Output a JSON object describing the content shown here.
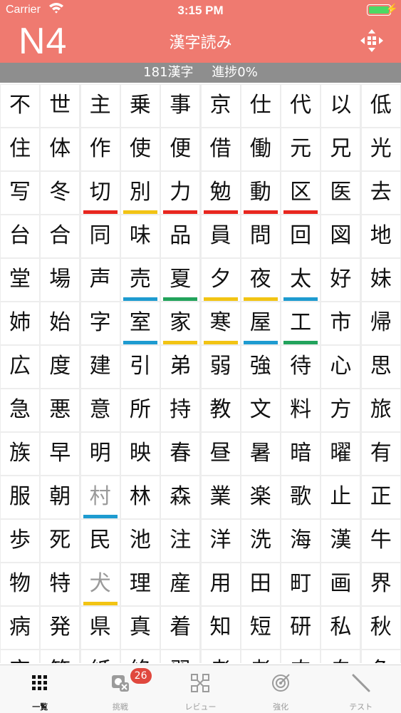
{
  "status_bar": {
    "carrier": "Carrier",
    "time": "3:15 PM"
  },
  "header": {
    "level": "N4",
    "title": "漢字読み",
    "menu_icon": "move-icon"
  },
  "progress": {
    "count_label": "181漢字",
    "progress_label": "進捗0%"
  },
  "colors": {
    "header": "#EF7A70",
    "progress_bar": "#8E8E8E",
    "red": "#E8261F",
    "yellow": "#F2C414",
    "blue": "#1E9BD0",
    "green": "#22A35C",
    "badge": "#E0483E"
  },
  "kanji_rows": [
    [
      {
        "k": "不"
      },
      {
        "k": "世"
      },
      {
        "k": "主"
      },
      {
        "k": "乗"
      },
      {
        "k": "事"
      },
      {
        "k": "京"
      },
      {
        "k": "仕"
      },
      {
        "k": "代"
      },
      {
        "k": "以"
      },
      {
        "k": "低"
      }
    ],
    [
      {
        "k": "住"
      },
      {
        "k": "体"
      },
      {
        "k": "作"
      },
      {
        "k": "使"
      },
      {
        "k": "便"
      },
      {
        "k": "借"
      },
      {
        "k": "働"
      },
      {
        "k": "元"
      },
      {
        "k": "兄"
      },
      {
        "k": "光"
      }
    ],
    [
      {
        "k": "写"
      },
      {
        "k": "冬"
      },
      {
        "k": "切",
        "m": "red"
      },
      {
        "k": "別",
        "m": "yellow"
      },
      {
        "k": "力",
        "m": "red"
      },
      {
        "k": "勉",
        "m": "red"
      },
      {
        "k": "動",
        "m": "red"
      },
      {
        "k": "区",
        "m": "red"
      },
      {
        "k": "医"
      },
      {
        "k": "去"
      }
    ],
    [
      {
        "k": "台"
      },
      {
        "k": "合"
      },
      {
        "k": "同"
      },
      {
        "k": "味"
      },
      {
        "k": "品"
      },
      {
        "k": "員"
      },
      {
        "k": "問"
      },
      {
        "k": "回"
      },
      {
        "k": "図"
      },
      {
        "k": "地"
      }
    ],
    [
      {
        "k": "堂"
      },
      {
        "k": "場"
      },
      {
        "k": "声"
      },
      {
        "k": "売",
        "m": "blue"
      },
      {
        "k": "夏",
        "m": "green"
      },
      {
        "k": "夕",
        "m": "yellow"
      },
      {
        "k": "夜",
        "m": "yellow"
      },
      {
        "k": "太",
        "m": "blue"
      },
      {
        "k": "好"
      },
      {
        "k": "妹"
      }
    ],
    [
      {
        "k": "姉"
      },
      {
        "k": "始"
      },
      {
        "k": "字"
      },
      {
        "k": "室",
        "m": "blue"
      },
      {
        "k": "家",
        "m": "yellow"
      },
      {
        "k": "寒",
        "m": "yellow"
      },
      {
        "k": "屋",
        "m": "blue"
      },
      {
        "k": "工",
        "m": "green"
      },
      {
        "k": "市"
      },
      {
        "k": "帰"
      }
    ],
    [
      {
        "k": "広"
      },
      {
        "k": "度"
      },
      {
        "k": "建"
      },
      {
        "k": "引"
      },
      {
        "k": "弟"
      },
      {
        "k": "弱"
      },
      {
        "k": "強"
      },
      {
        "k": "待"
      },
      {
        "k": "心"
      },
      {
        "k": "思"
      }
    ],
    [
      {
        "k": "急"
      },
      {
        "k": "悪"
      },
      {
        "k": "意"
      },
      {
        "k": "所"
      },
      {
        "k": "持"
      },
      {
        "k": "教"
      },
      {
        "k": "文"
      },
      {
        "k": "料"
      },
      {
        "k": "方"
      },
      {
        "k": "旅"
      }
    ],
    [
      {
        "k": "族"
      },
      {
        "k": "早"
      },
      {
        "k": "明"
      },
      {
        "k": "映"
      },
      {
        "k": "春"
      },
      {
        "k": "昼"
      },
      {
        "k": "暑"
      },
      {
        "k": "暗"
      },
      {
        "k": "曜"
      },
      {
        "k": "有"
      }
    ],
    [
      {
        "k": "服"
      },
      {
        "k": "朝"
      },
      {
        "k": "村",
        "m": "blue",
        "dim": true
      },
      {
        "k": "林"
      },
      {
        "k": "森"
      },
      {
        "k": "業"
      },
      {
        "k": "楽"
      },
      {
        "k": "歌"
      },
      {
        "k": "止"
      },
      {
        "k": "正"
      }
    ],
    [
      {
        "k": "歩"
      },
      {
        "k": "死"
      },
      {
        "k": "民"
      },
      {
        "k": "池"
      },
      {
        "k": "注"
      },
      {
        "k": "洋"
      },
      {
        "k": "洗"
      },
      {
        "k": "海"
      },
      {
        "k": "漢"
      },
      {
        "k": "牛"
      }
    ],
    [
      {
        "k": "物"
      },
      {
        "k": "特"
      },
      {
        "k": "犬",
        "m": "yellow",
        "dim": true
      },
      {
        "k": "理"
      },
      {
        "k": "産"
      },
      {
        "k": "用"
      },
      {
        "k": "田"
      },
      {
        "k": "町"
      },
      {
        "k": "画"
      },
      {
        "k": "界"
      }
    ],
    [
      {
        "k": "病"
      },
      {
        "k": "発"
      },
      {
        "k": "県"
      },
      {
        "k": "真"
      },
      {
        "k": "着"
      },
      {
        "k": "知"
      },
      {
        "k": "短"
      },
      {
        "k": "研"
      },
      {
        "k": "私"
      },
      {
        "k": "秋"
      }
    ],
    [
      {
        "k": "究"
      },
      {
        "k": "答"
      },
      {
        "k": "紙"
      },
      {
        "k": "終"
      },
      {
        "k": "習"
      },
      {
        "k": "考"
      },
      {
        "k": "者"
      },
      {
        "k": "肉"
      },
      {
        "k": "自"
      },
      {
        "k": "色"
      }
    ]
  ],
  "tabs": [
    {
      "label": "一覧",
      "icon": "grid-icon",
      "active": true
    },
    {
      "label": "挑戦",
      "icon": "challenge-icon",
      "badge": "26"
    },
    {
      "label": "レビュー",
      "icon": "review-icon"
    },
    {
      "label": "強化",
      "icon": "target-icon"
    },
    {
      "label": "テスト",
      "icon": "pencil-icon"
    }
  ]
}
